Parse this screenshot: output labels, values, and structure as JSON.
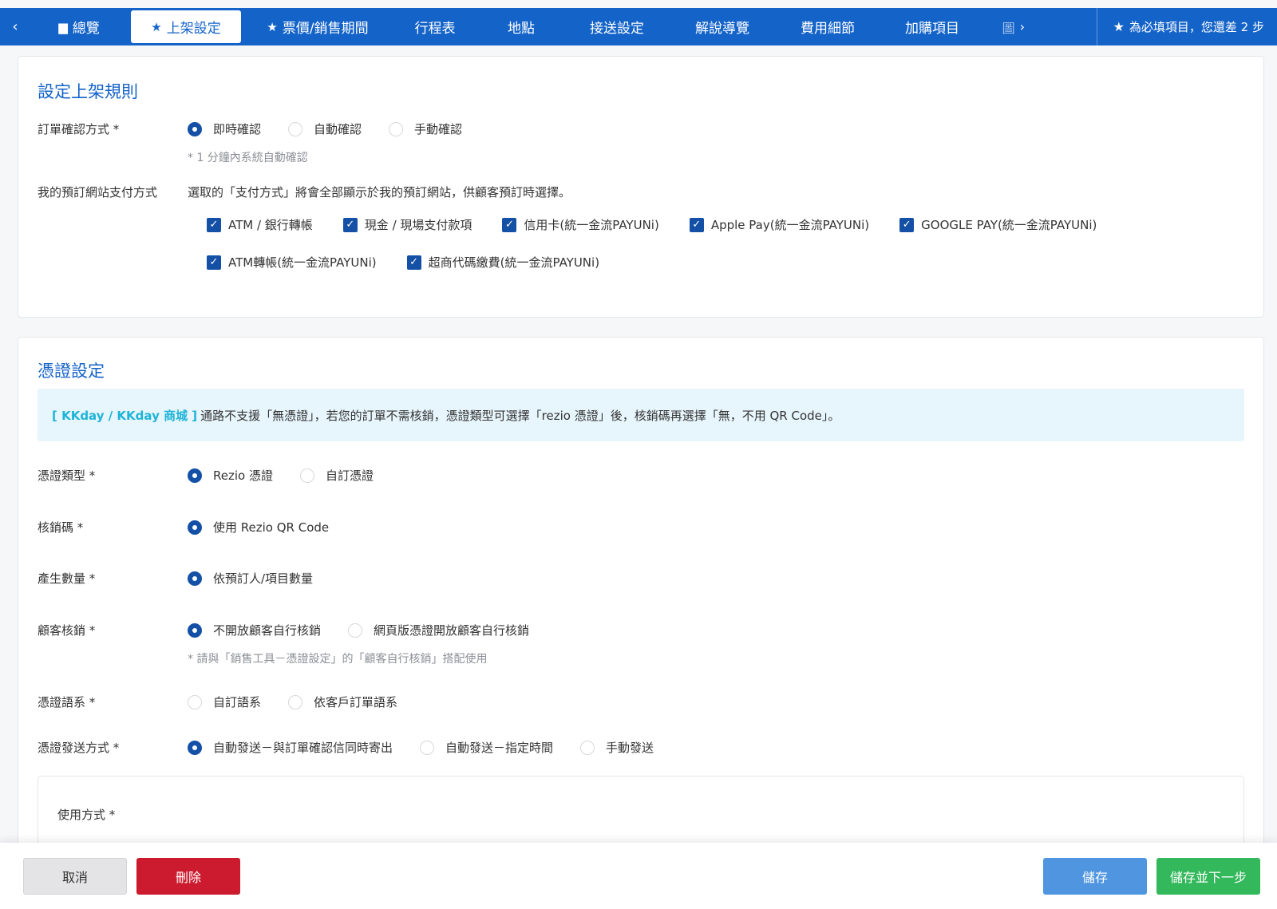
{
  "nav": {
    "tabs": [
      {
        "label": "總覽",
        "icon": "folder-icon"
      },
      {
        "label": "上架設定",
        "icon": "star-icon"
      },
      {
        "label": "票價/銷售期間",
        "icon": "star-icon"
      },
      {
        "label": "行程表"
      },
      {
        "label": "地點"
      },
      {
        "label": "接送設定"
      },
      {
        "label": "解說導覽"
      },
      {
        "label": "費用細節"
      },
      {
        "label": "加購項目"
      }
    ],
    "truncated_tab": "圖",
    "required_notice": "為必填項目，您還差 2 步"
  },
  "listing": {
    "title": "設定上架規則",
    "confirm": {
      "label": "訂單確認方式 *",
      "options": [
        "即時確認",
        "自動確認",
        "手動確認"
      ],
      "selected": 0,
      "hint": "* 1 分鐘內系統自動確認"
    },
    "payment": {
      "label": "我的預訂網站支付方式",
      "desc": "選取的「支付方式」將會全部顯示於我的預訂網站，供顧客預訂時選擇。",
      "methods": [
        "ATM / 銀行轉帳",
        "現金 / 現場支付款項",
        "信用卡(統一金流PAYUNi)",
        "Apple Pay(統一金流PAYUNi)",
        "GOOGLE PAY(統一金流PAYUNi)",
        "ATM轉帳(統一金流PAYUNi)",
        "超商代碼繳費(統一金流PAYUNi)"
      ]
    }
  },
  "voucher": {
    "title": "憑證設定",
    "notice_brand": "[ KKday / KKday 商城 ]",
    "notice_text": "通路不支援「無憑證」，若您的訂單不需核銷，憑證類型可選擇「rezio 憑證」後，核銷碼再選擇「無，不用 QR Code」。",
    "type": {
      "label": "憑證類型 *",
      "options": [
        "Rezio 憑證",
        "自訂憑證"
      ],
      "selected": 0
    },
    "code": {
      "label": "核銷碼 *",
      "options": [
        "使用 Rezio QR Code"
      ],
      "selected": 0
    },
    "quantity": {
      "label": "產生數量 *",
      "options": [
        "依預訂人/項目數量"
      ],
      "selected": 0
    },
    "redeem": {
      "label": "顧客核銷 *",
      "options": [
        "不開放顧客自行核銷",
        "網頁版憑證開放顧客自行核銷"
      ],
      "selected": 0,
      "hint": "* 請與「銷售工具－憑證設定」的「顧客自行核銷」搭配使用"
    },
    "language": {
      "label": "憑證語系 *",
      "options": [
        "自訂語系",
        "依客戶訂單語系"
      ],
      "selected": -1
    },
    "delivery": {
      "label": "憑證發送方式 *",
      "options": [
        "自動發送－與訂單確認信同時寄出",
        "自動發送－指定時間",
        "手動發送"
      ],
      "selected": 0
    },
    "usage_label": "使用方式 *"
  },
  "footer": {
    "cancel": "取消",
    "delete": "刪除",
    "save": "儲存",
    "save_next": "儲存並下一步"
  }
}
